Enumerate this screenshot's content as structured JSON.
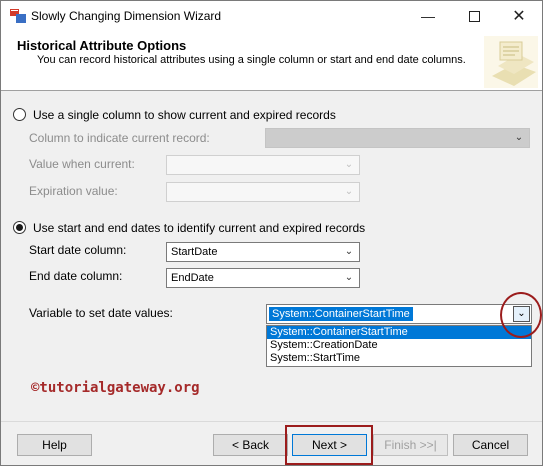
{
  "window": {
    "title": "Slowly Changing Dimension Wizard",
    "minimize": "—",
    "close": "✕"
  },
  "header": {
    "title": "Historical Attribute Options",
    "subtitle": "You can record historical attributes using a single column or start and end date columns."
  },
  "option_single": {
    "label": "Use a single column to show current and expired records",
    "selected": false,
    "column_label": "Column to indicate current record:",
    "current_label": "Value when current:",
    "expiration_label": "Expiration value:"
  },
  "option_dates": {
    "label": "Use start and end dates to identify current and expired records",
    "selected": true,
    "start_label": "Start date column:",
    "start_value": "StartDate",
    "end_label": "End date column:",
    "end_value": "EndDate",
    "variable_label": "Variable to set date values:",
    "variable_value": "System::ContainerStartTime",
    "variable_options": [
      "System::ContainerStartTime",
      "System::CreationDate",
      "System::StartTime"
    ],
    "variable_selected_index": 0
  },
  "watermark": "©tutorialgateway.org",
  "buttons": {
    "help": "Help",
    "back": "< Back",
    "next": "Next >",
    "finish": "Finish >>|",
    "cancel": "Cancel"
  },
  "icons": {
    "dropdown": "chevron-down-icon",
    "app": "wizard-app-icon"
  },
  "colors": {
    "highlight": "#0078d7",
    "annotation": "#9b1c1c",
    "watermark": "#a52a2a"
  }
}
